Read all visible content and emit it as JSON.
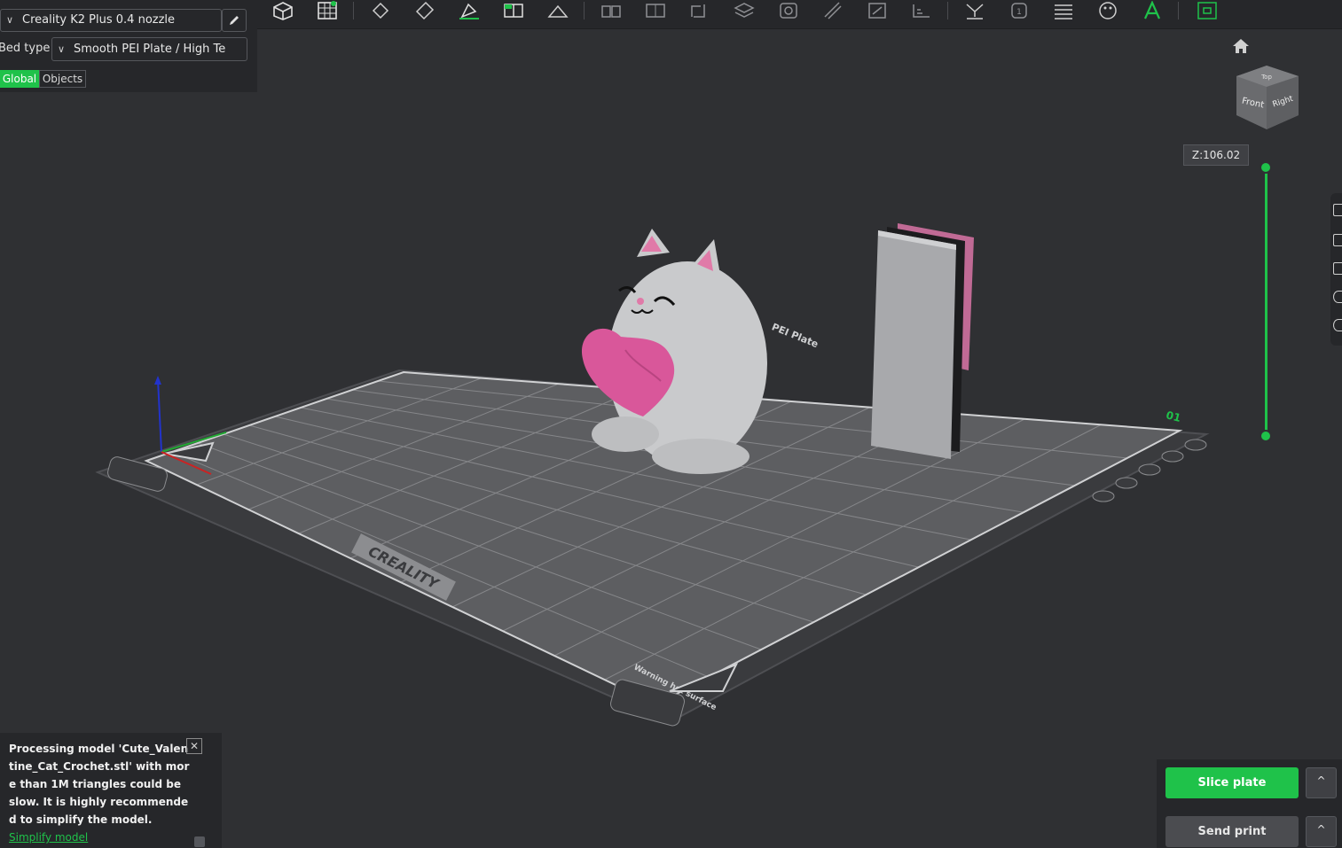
{
  "left_panel": {
    "printer": "Creality K2 Plus 0.4 nozzle",
    "bed_type_label": "Bed type",
    "bed_type_value": "Smooth PEI Plate / High Te",
    "tabs": [
      "Global",
      "Objects"
    ]
  },
  "toolbar": {
    "icons": [
      "add-cube-icon",
      "plate-grid-icon",
      "arrange-icon",
      "orient-icon",
      "lay-on-face-icon",
      "split-icon",
      "cut-icon",
      "multi-object-icon",
      "group-icon",
      "measure-icon",
      "layers-icon",
      "paint-support-icon",
      "seam-icon",
      "fuzzy-skin-icon",
      "variable-layer-icon",
      "support-icon",
      "brim-icon",
      "list-icon",
      "color-paint-icon",
      "text-icon",
      "assembly-icon"
    ]
  },
  "viewport": {
    "z_label": "Z:106.02",
    "cube_faces": {
      "top": "Top",
      "front": "Front",
      "right": "Right"
    },
    "bed_texts": {
      "brand": "CREALITY",
      "plate": "PEI Plate",
      "warning": "Warning hot surface",
      "plate_number": "01"
    }
  },
  "notification": {
    "message": "Processing model 'Cute_Valentine_Cat_Crochet.stl' with more than 1M triangles could be slow. It is highly recommended to simplify the model.",
    "link": "Simplify model"
  },
  "actions": {
    "slice": "Slice plate",
    "send": "Send print",
    "caret": "^"
  },
  "colors": {
    "accent": "#1fc24a",
    "panel": "#26272a",
    "background": "#2f3033"
  }
}
